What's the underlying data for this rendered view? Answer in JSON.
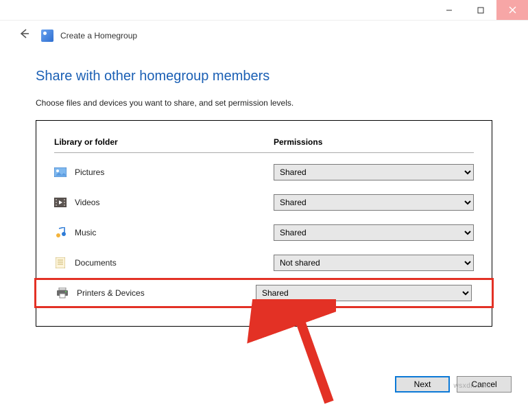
{
  "window": {
    "title": "Create a Homegroup"
  },
  "main": {
    "heading": "Share with other homegroup members",
    "instruction": "Choose files and devices you want to share, and set permission levels.",
    "columns": {
      "library": "Library or folder",
      "permissions": "Permissions"
    },
    "rows": [
      {
        "label": "Pictures",
        "value": "Shared",
        "icon": "pictures"
      },
      {
        "label": "Videos",
        "value": "Shared",
        "icon": "videos"
      },
      {
        "label": "Music",
        "value": "Shared",
        "icon": "music"
      },
      {
        "label": "Documents",
        "value": "Not shared",
        "icon": "documents"
      },
      {
        "label": "Printers & Devices",
        "value": "Shared",
        "icon": "printers"
      }
    ],
    "options": [
      "Shared",
      "Not shared"
    ]
  },
  "footer": {
    "next": "Next",
    "cancel": "Cancel"
  },
  "watermark": "wsxdn.com"
}
